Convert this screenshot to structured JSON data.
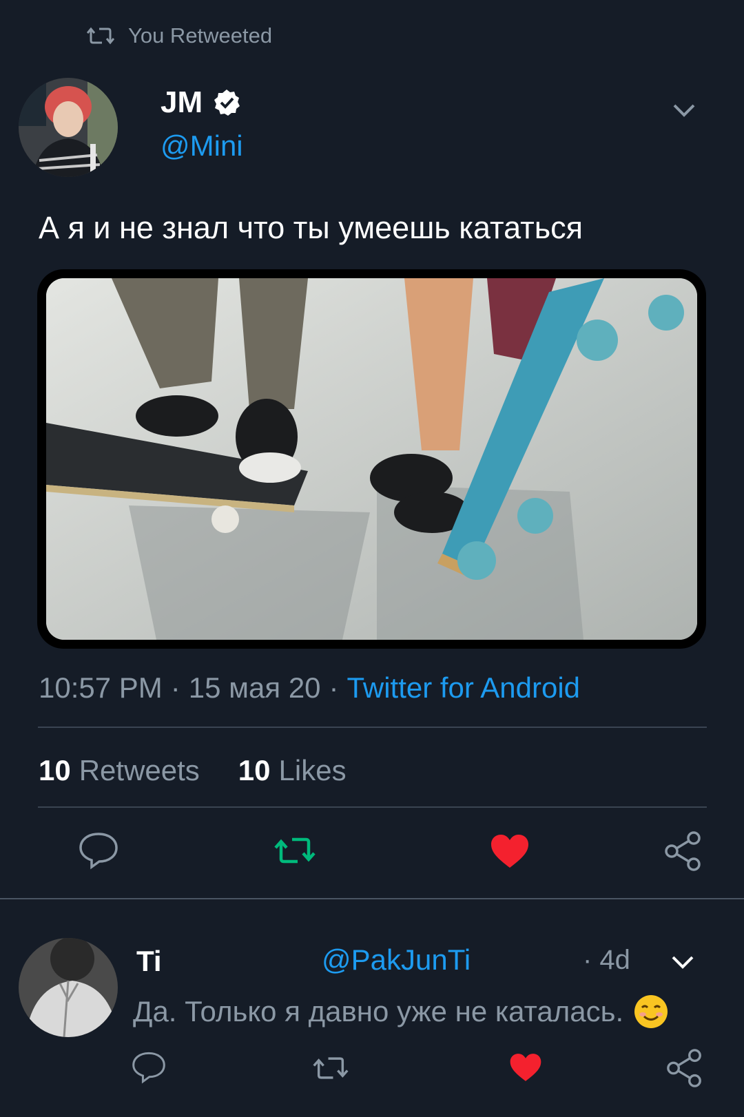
{
  "retweet_banner": {
    "label": "You Retweeted",
    "icon": "retweet-icon"
  },
  "tweet": {
    "author_name": "JM",
    "author_handle": "@Mini",
    "verified": true,
    "text": "А я и не знал что ты умеешь кататься",
    "time": "10:57 PM",
    "date": "15 мая 20",
    "app": "Twitter for Android",
    "retweet_count": "10",
    "retweet_label": "Retweets",
    "like_count": "10",
    "like_label": "Likes",
    "liked": true,
    "retweeted": true
  },
  "reply": {
    "author_name": "Ti",
    "author_handle": "@PakJunTi",
    "age": "· 4d",
    "text": "Да. Только я давно уже не каталась.",
    "emoji": "smiling-face-icon"
  },
  "colors": {
    "background": "#151c27",
    "accent": "#1d9bf0",
    "like": "#f4212e",
    "retweet": "#00ba7c",
    "muted": "#8b98a5"
  }
}
